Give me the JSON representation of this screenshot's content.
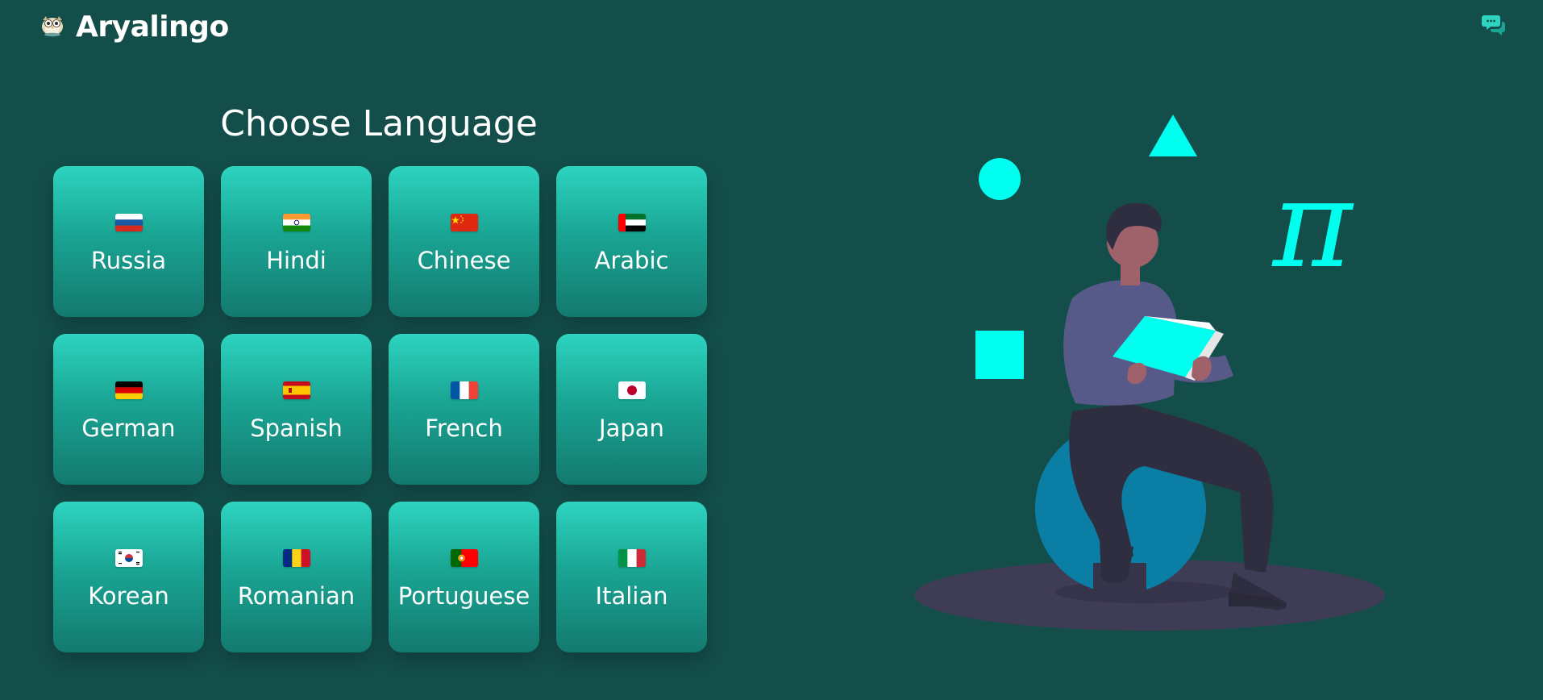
{
  "header": {
    "app_title": "Aryalingo",
    "logo_icon": "owl-logo-icon",
    "chat_icon": "chat-bubbles-icon"
  },
  "main": {
    "title": "Choose Language",
    "languages": [
      {
        "label": "Russia",
        "flag": "russia-flag-icon"
      },
      {
        "label": "Hindi",
        "flag": "india-flag-icon"
      },
      {
        "label": "Chinese",
        "flag": "china-flag-icon"
      },
      {
        "label": "Arabic",
        "flag": "uae-flag-icon"
      },
      {
        "label": "German",
        "flag": "germany-flag-icon"
      },
      {
        "label": "Spanish",
        "flag": "spain-flag-icon"
      },
      {
        "label": "French",
        "flag": "france-flag-icon"
      },
      {
        "label": "Japan",
        "flag": "japan-flag-icon"
      },
      {
        "label": "Korean",
        "flag": "south-korea-flag-icon"
      },
      {
        "label": "Romanian",
        "flag": "romania-flag-icon"
      },
      {
        "label": "Portuguese",
        "flag": "portugal-flag-icon"
      },
      {
        "label": "Italian",
        "flag": "italy-flag-icon"
      }
    ]
  },
  "illustration": {
    "pi_symbol": "π",
    "description_icon": "person-reading-book-illustration"
  },
  "colors": {
    "background": "#134e4a",
    "card_top": "#2dd4bf",
    "card_bottom": "#137a6e",
    "accent_cyan": "#00ffee",
    "text": "#ffffff"
  }
}
